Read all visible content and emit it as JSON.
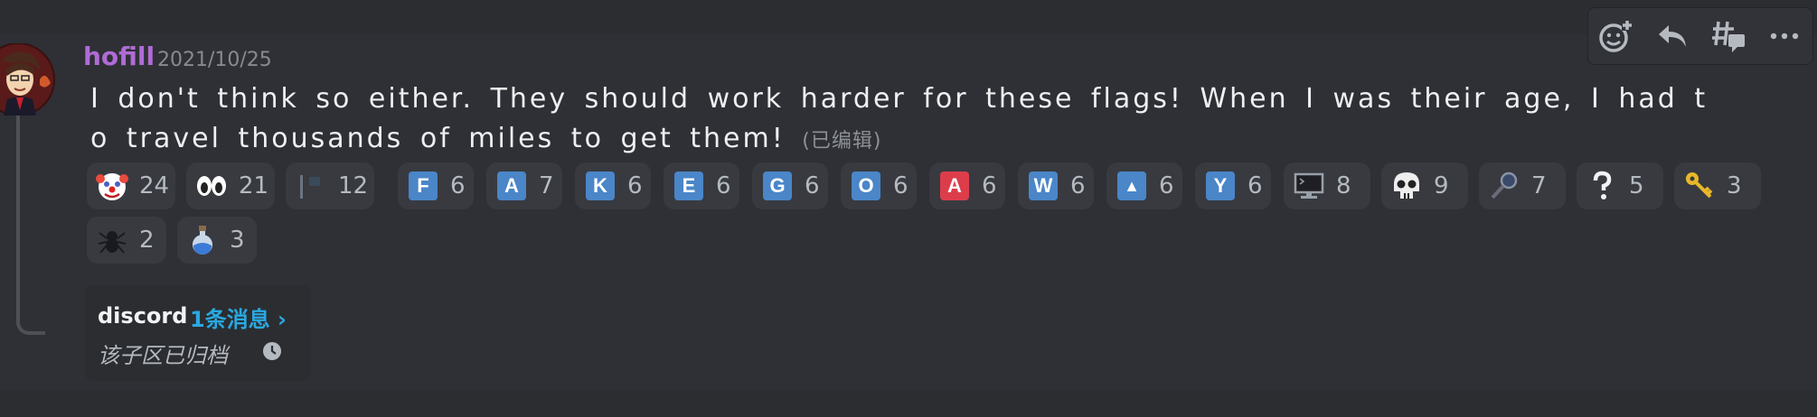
{
  "toolbar": {
    "add_reaction": "add-reaction-icon",
    "reply": "reply-icon",
    "create_thread": "thread-icon",
    "more": "more-icon"
  },
  "message": {
    "username": "hofill",
    "timestamp": "2021/10/25",
    "line1": "I don't think so either. They should work harder for these flags! When I was their age, I had t",
    "line2": "o travel thousands of miles to get them!",
    "edited": "(已编辑)"
  },
  "reactions": [
    {
      "emoji": "clown-face-icon",
      "count": "24"
    },
    {
      "emoji": "eyes-icon",
      "count": "21"
    },
    {
      "emoji": "flag-icon",
      "count": "12"
    },
    {
      "emoji": "letter-f-icon",
      "letter": "F",
      "color": "#4a86c8",
      "count": "6"
    },
    {
      "emoji": "letter-a-icon",
      "letter": "A",
      "color": "#4a86c8",
      "count": "7"
    },
    {
      "emoji": "letter-k-icon",
      "letter": "K",
      "color": "#4a86c8",
      "count": "6"
    },
    {
      "emoji": "letter-e-icon",
      "letter": "E",
      "color": "#4a86c8",
      "count": "6"
    },
    {
      "emoji": "letter-g-icon",
      "letter": "G",
      "color": "#4a86c8",
      "count": "6"
    },
    {
      "emoji": "letter-o-icon",
      "letter": "O",
      "color": "#4a86c8",
      "count": "6"
    },
    {
      "emoji": "letter-a-red-icon",
      "letter": "A",
      "color": "#dd3d4b",
      "count": "6"
    },
    {
      "emoji": "letter-w-icon",
      "letter": "W",
      "color": "#4a86c8",
      "count": "6"
    },
    {
      "emoji": "triangle-icon",
      "letter": "▲",
      "color": "#4a86c8",
      "count": "6"
    },
    {
      "emoji": "letter-y-icon",
      "letter": "Y",
      "color": "#4a86c8",
      "count": "6"
    },
    {
      "emoji": "computer-icon",
      "count": "8"
    },
    {
      "emoji": "skull-icon",
      "count": "9"
    },
    {
      "emoji": "magnifier-icon",
      "count": "7"
    },
    {
      "emoji": "question-icon",
      "count": "5"
    },
    {
      "emoji": "key-icon",
      "count": "3"
    },
    {
      "emoji": "spider-icon",
      "count": "2"
    },
    {
      "emoji": "potion-icon",
      "count": "3"
    }
  ],
  "thread": {
    "name": "discord",
    "count": "1条消息 ›",
    "archived": "该子区已归档"
  },
  "colors": {
    "username": "#b06bd6",
    "link": "#2aa8e0"
  }
}
